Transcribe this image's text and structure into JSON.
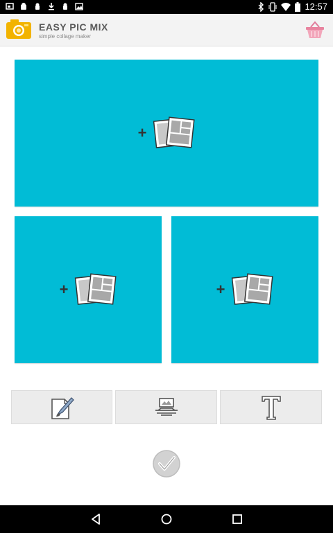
{
  "status_bar": {
    "time": "12:57",
    "left_icons": [
      "screenshot-icon",
      "android-icon",
      "android-icon",
      "download-icon",
      "android-icon",
      "gallery-icon"
    ],
    "right_icons": [
      "bluetooth-icon",
      "vibrate-icon",
      "wifi-icon",
      "battery-icon"
    ]
  },
  "app_bar": {
    "title": "EASY PIC MIX",
    "subtitle": "simple collage maker",
    "logo_icon": "camera-icon",
    "store_icon": "basket-icon"
  },
  "collage": {
    "background_color": "#01bcd6",
    "cells": [
      {
        "name": "top",
        "plus": "+",
        "icon": "add-photos-icon"
      },
      {
        "name": "bottom-left",
        "plus": "+",
        "icon": "add-photos-icon"
      },
      {
        "name": "bottom-right",
        "plus": "+",
        "icon": "add-photos-icon"
      }
    ]
  },
  "toolbar": {
    "buttons": [
      {
        "name": "edit-layout",
        "icon": "document-brush-icon"
      },
      {
        "name": "frame",
        "icon": "frame-stamp-icon"
      },
      {
        "name": "text",
        "icon": "text-t-icon"
      }
    ]
  },
  "confirm": {
    "icon": "checkmark-icon"
  },
  "nav_bar": {
    "icons": [
      "back-icon",
      "home-icon",
      "recent-apps-icon"
    ]
  }
}
